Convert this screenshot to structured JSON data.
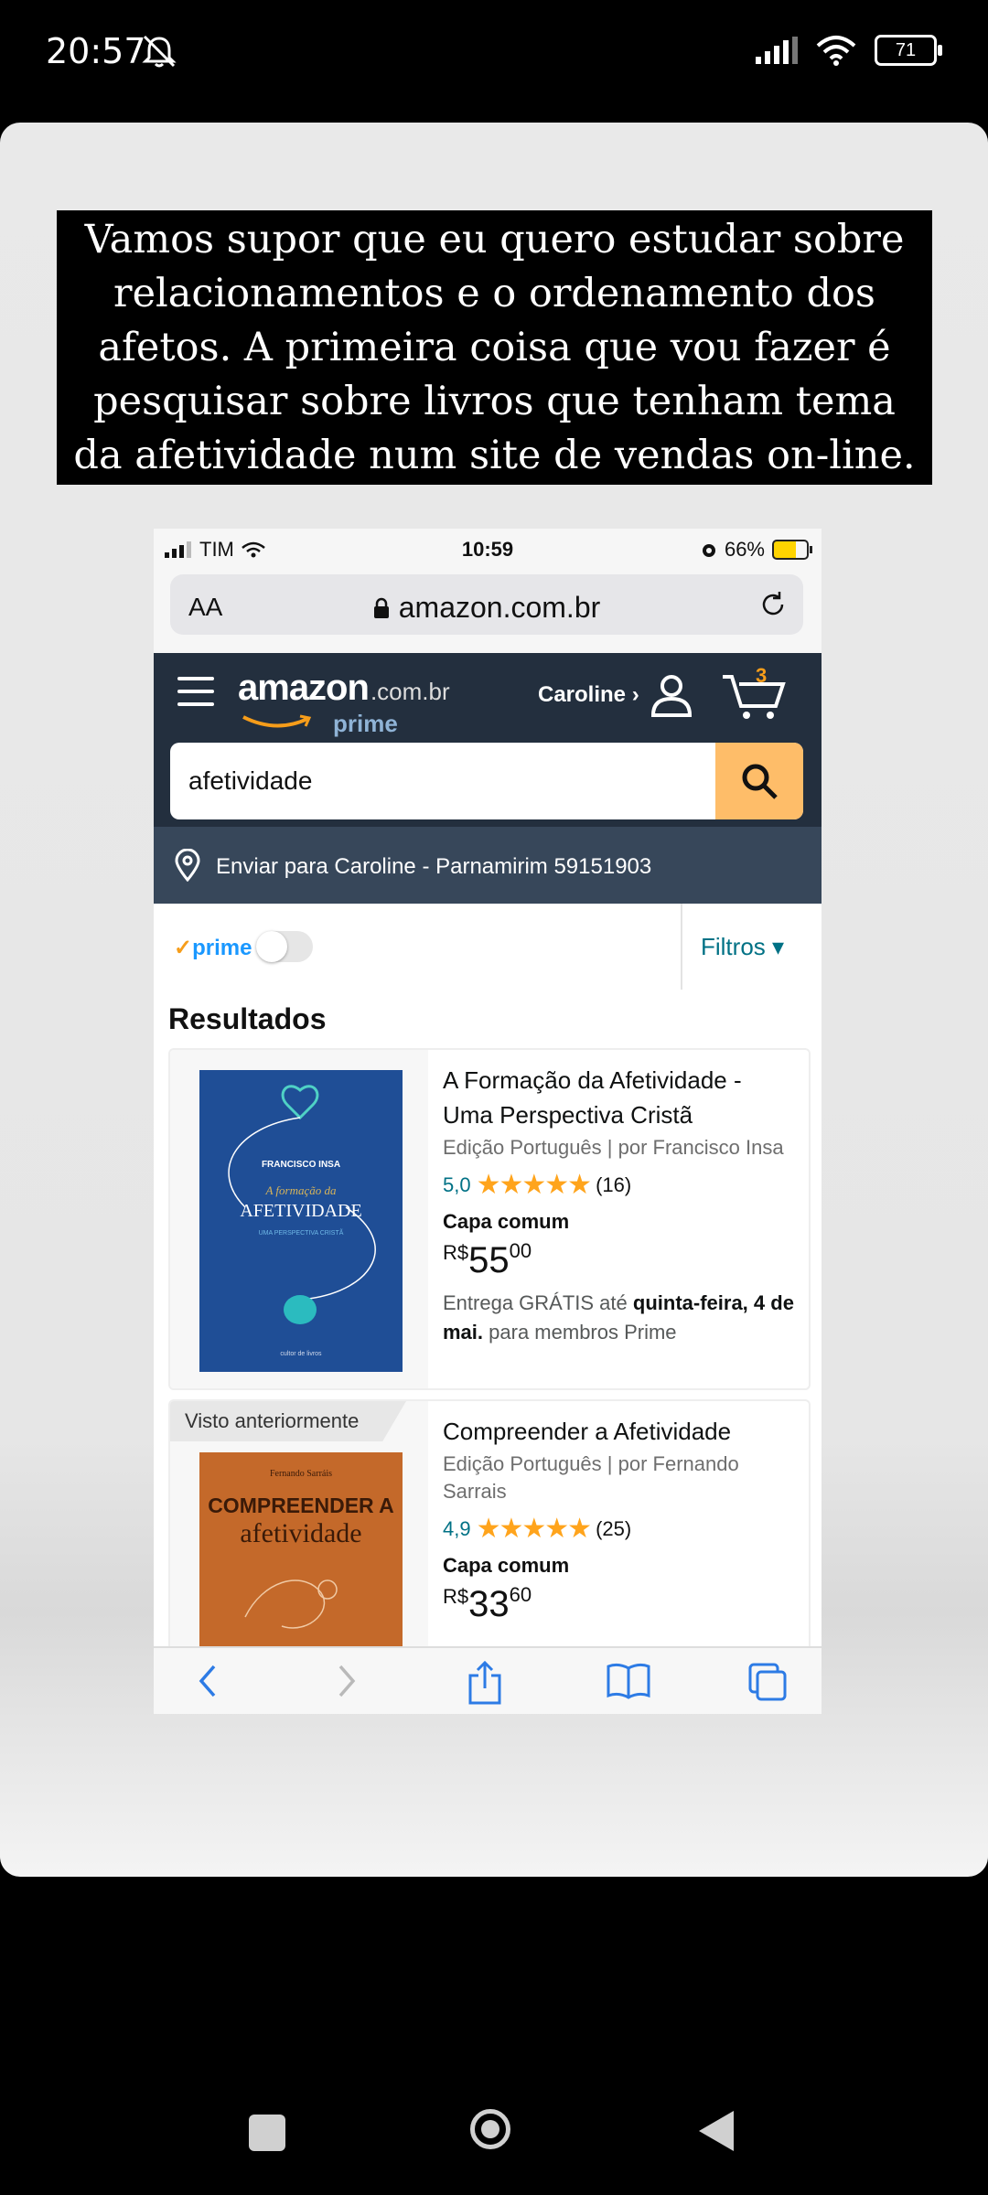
{
  "status_bar": {
    "time": "20:57",
    "battery": "71"
  },
  "story": {
    "caption": "Vamos supor que eu quero estudar sobre relacionamentos e o ordenamento dos afetos. A primeira coisa que vou fazer é pesquisar sobre livros que tenham tema da afetividade num site de vendas on-line."
  },
  "ios": {
    "carrier": "TIM",
    "time": "10:59",
    "battery": "66%",
    "aa_label": "AA",
    "url": "amazon.com.br"
  },
  "amazon": {
    "logo": "amazon",
    "logo_domain": ".com.br",
    "logo_prime": "prime",
    "account_label": "Caroline ›",
    "cart_count": "3",
    "search_value": "afetividade",
    "deliver_text": "Enviar para Caroline - Parnamirim 59151903",
    "prime_toggle_label": "prime",
    "filters_label": "Filtros ▾",
    "results_heading": "Resultados",
    "products": [
      {
        "title": "A Formação da Afetividade - Uma Perspectiva Cristã",
        "meta": "Edição Português  |  por Francisco Insa",
        "rating": "5,0",
        "stars": "★★★★★",
        "reviews": "(16)",
        "format": "Capa comum",
        "price_currency": "R$",
        "price_int": "55",
        "price_dec": "00",
        "delivery_prefix": "Entrega GRÁTIS até",
        "delivery_date": "quinta-feira, 4 de mai.",
        "delivery_suffix": "para membros Prime",
        "cover": {
          "author": "FRANCISCO INSA",
          "subtitle_small": "A formação da",
          "title": "AFETIVIDADE",
          "tagline": "UMA PERSPECTIVA CRISTÃ",
          "publisher": "cultor de livros",
          "color": "#1f4e96"
        }
      },
      {
        "badge": "Visto anteriormente",
        "title": "Compreender a Afetividade",
        "meta": "Edição Português  |  por Fernando Sarrais",
        "rating": "4,9",
        "stars": "★★★★★",
        "reviews": "(25)",
        "format": "Capa comum",
        "price_currency": "R$",
        "price_int": "33",
        "price_dec": "60",
        "cover": {
          "author": "Fernando Sarráis",
          "line1": "COMPREENDER A",
          "line2": "afetividade",
          "color": "#c4692a"
        }
      }
    ]
  },
  "colors": {
    "amazon_header": "#232f3e",
    "amazon_deliver": "#37475a",
    "search_button": "#febd69",
    "star": "#ffa41c",
    "link": "#007185"
  }
}
